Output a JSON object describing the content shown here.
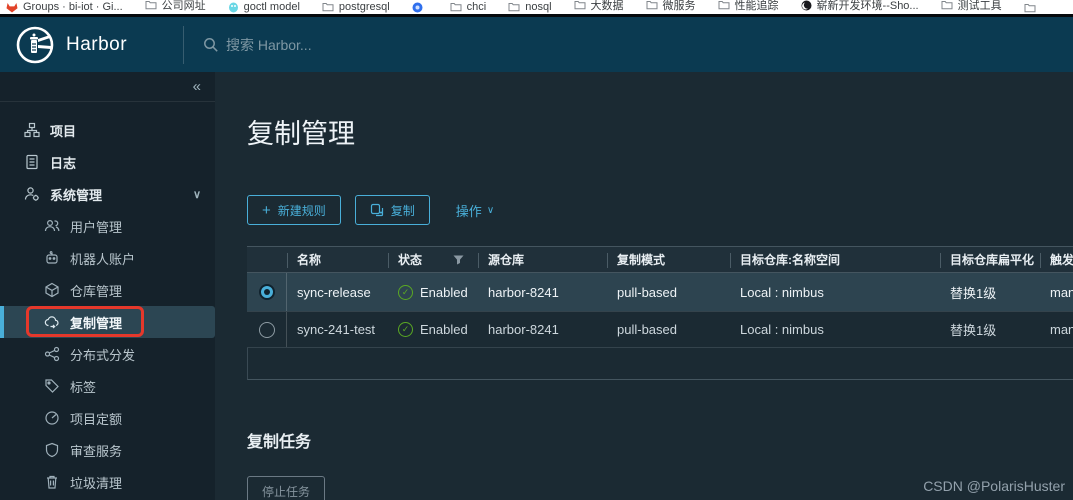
{
  "bookmarks_bar": {
    "items": [
      {
        "icon": "gitlab-icon",
        "label": "Groups · bi-iot · Gi..."
      },
      {
        "icon": "folder-icon",
        "label": "公司网址"
      },
      {
        "icon": "gopher-icon",
        "label": "goctl model"
      },
      {
        "icon": "folder-icon",
        "label": "postgresql"
      },
      {
        "icon": "blue-app-icon",
        "label": ""
      },
      {
        "icon": "folder-icon",
        "label": "chci"
      },
      {
        "icon": "folder-icon",
        "label": "nosql"
      },
      {
        "icon": "folder-icon",
        "label": "大数据"
      },
      {
        "icon": "folder-icon",
        "label": "微服务"
      },
      {
        "icon": "folder-icon",
        "label": "性能追踪"
      },
      {
        "icon": "dark-app-icon",
        "label": "崭新开发环境--Sho..."
      },
      {
        "icon": "folder-icon",
        "label": "测试工具"
      },
      {
        "icon": "folder-icon",
        "label": ""
      }
    ]
  },
  "header": {
    "brand": "Harbor",
    "search_placeholder": "搜索 Harbor..."
  },
  "sidebar": {
    "collapse_glyph": "«",
    "expand_chevron": "∨",
    "items": [
      {
        "label": "项目",
        "icon": "projects-icon"
      },
      {
        "label": "日志",
        "icon": "logs-icon"
      },
      {
        "label": "系统管理",
        "icon": "system-admin-icon",
        "expanded": true
      }
    ],
    "sub_items": [
      {
        "label": "用户管理",
        "icon": "users-icon"
      },
      {
        "label": "机器人账户",
        "icon": "robot-icon"
      },
      {
        "label": "仓库管理",
        "icon": "registry-icon"
      },
      {
        "label": "复制管理",
        "icon": "replication-icon",
        "selected": true,
        "annotated": true
      },
      {
        "label": "分布式分发",
        "icon": "distribution-icon"
      },
      {
        "label": "标签",
        "icon": "tag-icon"
      },
      {
        "label": "项目定额",
        "icon": "quota-icon"
      },
      {
        "label": "审查服务",
        "icon": "scan-service-icon"
      },
      {
        "label": "垃圾清理",
        "icon": "garbage-icon"
      }
    ]
  },
  "main": {
    "title": "复制管理",
    "toolbar": {
      "plus_glyph": "+",
      "new_rule": "新建规则",
      "replicate": "复制",
      "actions": "操作",
      "chevron": "∨"
    },
    "table": {
      "columns": {
        "name": "名称",
        "status": "状态",
        "source_registry": "源仓库",
        "replication_mode": "复制模式",
        "destination": "目标仓库:名称空间",
        "flattening": "目标仓库扁平化",
        "trigger": "触发模式"
      },
      "status_check_glyph": "✓",
      "rows": [
        {
          "selected": true,
          "name": "sync-release",
          "status": "Enabled",
          "source": "harbor-8241",
          "mode": "pull-based",
          "dest": "Local : nimbus",
          "flatten": "替换1级",
          "trigger": "manual"
        },
        {
          "selected": false,
          "name": "sync-241-test",
          "status": "Enabled",
          "source": "harbor-8241",
          "mode": "pull-based",
          "dest": "Local : nimbus",
          "flatten": "替换1级",
          "trigger": "manual"
        }
      ]
    },
    "tasks": {
      "title": "复制任务",
      "stop_button": "停止任务"
    }
  },
  "watermark": "CSDN @PolarisHuster",
  "colors": {
    "accent_blue": "#49afd9",
    "header_bg": "#0b3a51",
    "sidebar_bg": "#15222b",
    "content_bg": "#1b2a33",
    "selected_row_bg": "#2d4450",
    "enabled_green": "#5aa823",
    "annotation_red": "#e5382b"
  }
}
